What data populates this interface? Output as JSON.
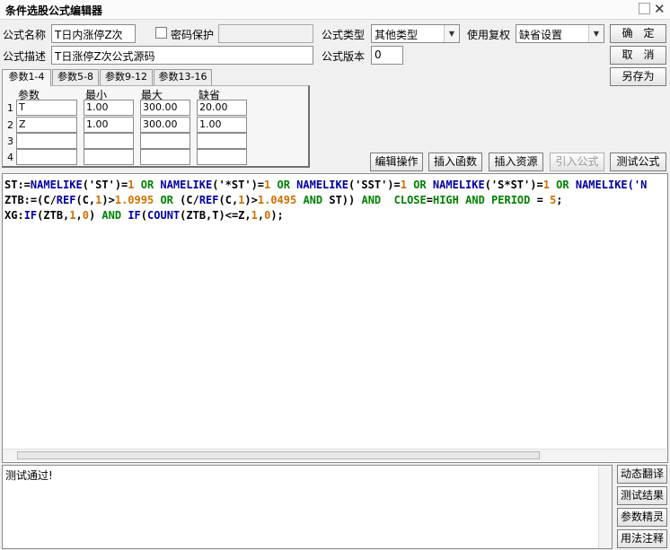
{
  "window": {
    "title": "条件选股公式编辑器"
  },
  "form": {
    "name_label": "公式名称",
    "name_value": "T日内涨停Z次",
    "password_label": "密码保护",
    "password_checked": false,
    "password_value": "",
    "type_label": "公式类型",
    "type_value": "其他类型",
    "fq_label": "使用复权",
    "fq_value": "缺省设置",
    "desc_label": "公式描述",
    "desc_value": "T日涨停Z次公式源码",
    "version_label": "公式版本",
    "version_value": "0"
  },
  "buttons": {
    "ok": "确　定",
    "cancel": "取　消",
    "save_as": "另存为",
    "edit_ops": "编辑操作",
    "insert_func": "插入函数",
    "insert_res": "插入资源",
    "import_formula": "引入公式",
    "test_formula": "测试公式",
    "dynamic_translate": "动态翻译",
    "test_result": "测试结果",
    "param_tuning": "参数精灵",
    "usage_notes": "用法注释"
  },
  "tabs": [
    "参数1-4",
    "参数5-8",
    "参数9-12",
    "参数13-16"
  ],
  "params": {
    "headers": [
      "参数",
      "最小",
      "最大",
      "缺省"
    ],
    "rows": [
      {
        "no": "1",
        "name": "T",
        "min": "1.00",
        "max": "300.00",
        "default": "20.00"
      },
      {
        "no": "2",
        "name": "Z",
        "min": "1.00",
        "max": "300.00",
        "default": "1.00"
      },
      {
        "no": "3",
        "name": "",
        "min": "",
        "max": "",
        "default": ""
      },
      {
        "no": "4",
        "name": "",
        "min": "",
        "max": "",
        "default": ""
      }
    ]
  },
  "code": {
    "lines": [
      [
        [
          "ST:=",
          "op"
        ],
        [
          "NAMELIKE",
          "fn"
        ],
        [
          "('ST')=",
          "op"
        ],
        [
          "1",
          "num"
        ],
        [
          " OR ",
          "kw"
        ],
        [
          "NAMELIKE",
          "fn"
        ],
        [
          "('*ST')=",
          "op"
        ],
        [
          "1",
          "num"
        ],
        [
          " OR ",
          "kw"
        ],
        [
          "NAMELIKE",
          "fn"
        ],
        [
          "('SST')=",
          "op"
        ],
        [
          "1",
          "num"
        ],
        [
          " OR ",
          "kw"
        ],
        [
          "NAMELIKE",
          "fn"
        ],
        [
          "('S*ST')=",
          "op"
        ],
        [
          "1",
          "num"
        ],
        [
          " OR ",
          "kw"
        ],
        [
          "NAMELIKE('N",
          "fn"
        ]
      ],
      [
        [
          "ZTB:=(C/",
          "op"
        ],
        [
          "REF",
          "fn"
        ],
        [
          "(C,",
          "op"
        ],
        [
          "1",
          "num"
        ],
        [
          ")>",
          "op"
        ],
        [
          "1.0995",
          "num"
        ],
        [
          " OR ",
          "kw"
        ],
        [
          "(C/",
          "op"
        ],
        [
          "REF",
          "fn"
        ],
        [
          "(C,",
          "op"
        ],
        [
          "1",
          "num"
        ],
        [
          ")>",
          "op"
        ],
        [
          "1.0495",
          "num"
        ],
        [
          " AND ",
          "kw"
        ],
        [
          "ST)) ",
          "op"
        ],
        [
          "AND",
          "kw"
        ],
        [
          "  ",
          "op"
        ],
        [
          "CLOSE",
          "kw"
        ],
        [
          "=",
          "op"
        ],
        [
          "HIGH",
          "kw"
        ],
        [
          " AND ",
          "kw"
        ],
        [
          "PERIOD",
          "kw"
        ],
        [
          " = ",
          "op"
        ],
        [
          "5",
          "num"
        ],
        [
          ";",
          "op"
        ]
      ],
      [
        [
          "XG:",
          "op"
        ],
        [
          "IF",
          "fn"
        ],
        [
          "(ZTB,",
          "op"
        ],
        [
          "1",
          "num"
        ],
        [
          ",",
          "op"
        ],
        [
          "0",
          "num"
        ],
        [
          ") ",
          "op"
        ],
        [
          "AND ",
          "kw"
        ],
        [
          "IF",
          "fn"
        ],
        [
          "(",
          "op"
        ],
        [
          "COUNT",
          "fn"
        ],
        [
          "(ZTB,T)<=Z,",
          "op"
        ],
        [
          "1",
          "num"
        ],
        [
          ",",
          "op"
        ],
        [
          "0",
          "num"
        ],
        [
          ");",
          "op"
        ]
      ]
    ]
  },
  "output": {
    "text": "测试通过!"
  },
  "colors": {
    "function": "#0000a0",
    "keyword": "#008000",
    "number": "#d07000"
  }
}
